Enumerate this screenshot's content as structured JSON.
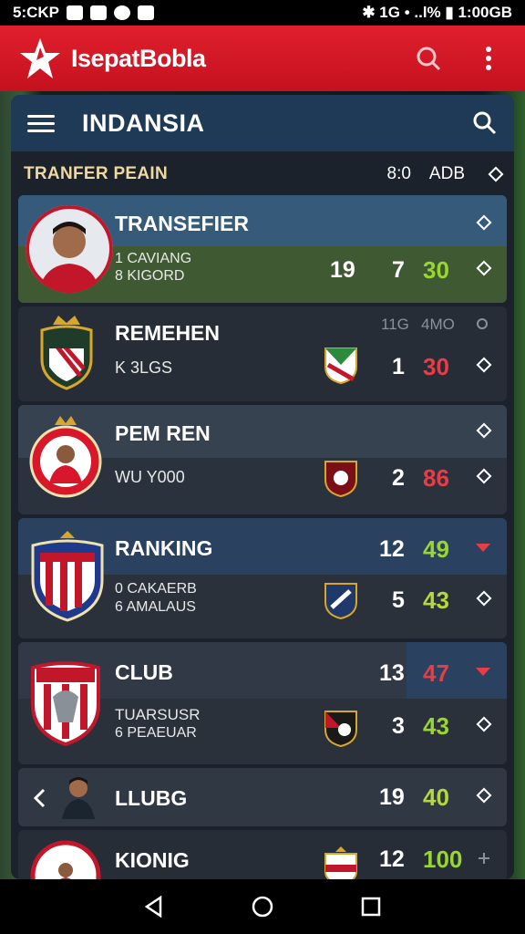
{
  "status_bar": {
    "time": "5:CKP",
    "right_text": "✱ 1G • ..l% ▮ 1:00GB"
  },
  "app": {
    "title": "IsepatBobla"
  },
  "panel": {
    "title": "INDANSIA",
    "subheader": {
      "label": "TRANFER PEAIN",
      "stat1": "8:0",
      "stat2": "ADB"
    }
  },
  "rows": [
    {
      "name": "TRANSEFIER",
      "sub1": "1 CAVIANG",
      "sub2": "8 KIGORD",
      "num1": "19",
      "num2": "7",
      "score": "30"
    },
    {
      "name": "REMEHEN",
      "sub1": "K 3LGS",
      "sub2": "",
      "top1": "11G",
      "top2": "4MO",
      "num2": "1",
      "score": "30"
    },
    {
      "name": "PEM REN",
      "sub1": "WU Y000",
      "sub2": "",
      "num2": "2",
      "score": "86"
    },
    {
      "name": "RANKING",
      "sub1": "0 CAKAERB",
      "sub2": "6 AMALAUS",
      "num1": "12",
      "score1": "49",
      "num2": "5",
      "score": "43"
    },
    {
      "name": "CLUB",
      "sub1": "TUARSUSR",
      "sub2": "6 PEAEUAR",
      "num1": "13",
      "score1": "47",
      "num2": "3",
      "score": "43"
    },
    {
      "name": "LLUBG",
      "num1": "19",
      "score": "40"
    },
    {
      "name": "KIONIG",
      "num1": "12",
      "score": "100"
    }
  ],
  "colors": {
    "brand_red": "#d8172a",
    "panel_header": "#1f3a56",
    "highlight_green": "#3f5a32",
    "score_green": "#9ad632",
    "score_red": "#e83c46"
  },
  "icons": [
    "logo-icon",
    "search-icon",
    "overflow-menu-icon",
    "menu-icon",
    "back-icon",
    "home-icon",
    "recents-icon"
  ]
}
